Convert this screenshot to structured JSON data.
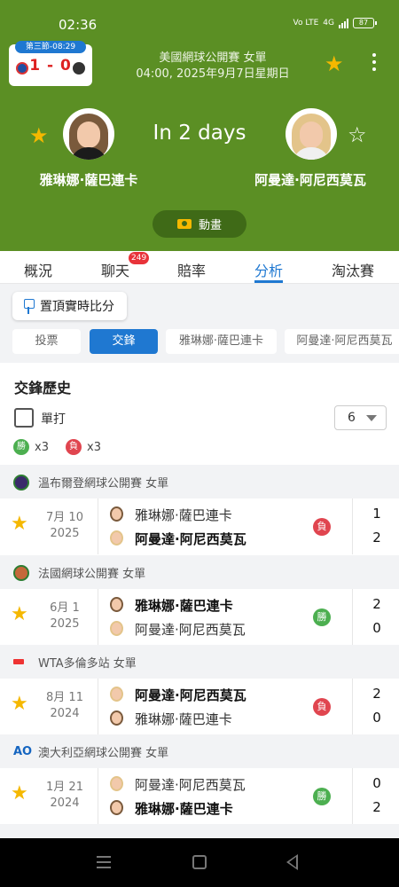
{
  "status_bar": {
    "time": "02:36",
    "net": "Vo LTE",
    "signal": "4G",
    "battery": "87"
  },
  "live_card": {
    "period": "第三節-08:29",
    "score": "1 - 0"
  },
  "event": {
    "title": "美國網球公開賽 女單",
    "datetime": "04:00, 2025年9月7日星期日"
  },
  "players": {
    "left": "雅琳娜·薩巴連卡",
    "right": "阿曼達·阿尼西莫瓦"
  },
  "countdown": "In 2 days",
  "animation_label": "動畫",
  "tabs": [
    "概況",
    "聊天",
    "賠率",
    "分析",
    "淘汰賽"
  ],
  "chat_badge": "249",
  "pin_label": "置頂實時比分",
  "chips": [
    "投票",
    "交鋒",
    "雅琳娜·薩巴連卡",
    "阿曼達·阿尼西莫瓦"
  ],
  "h2h": {
    "title": "交鋒歷史",
    "single_label": "單打",
    "count": "6",
    "win_badge": "勝",
    "loss_badge": "負",
    "wins": "x3",
    "losses": "x3"
  },
  "matches": [
    {
      "competition": "溫布爾登網球公開賽 女單",
      "date": "7月 10",
      "year": "2025",
      "p1": "雅琳娜·薩巴連卡",
      "p2": "阿曼達·阿尼西莫瓦",
      "result": "負",
      "s1": "1",
      "s2": "2"
    },
    {
      "competition": "法國網球公開賽 女單",
      "date": "6月 1",
      "year": "2025",
      "p1": "雅琳娜·薩巴連卡",
      "p2": "阿曼達·阿尼西莫瓦",
      "result": "勝",
      "s1": "2",
      "s2": "0"
    },
    {
      "competition": "WTA多倫多站 女單",
      "date": "8月 11",
      "year": "2024",
      "p1": "阿曼達·阿尼西莫瓦",
      "p2": "雅琳娜·薩巴連卡",
      "result": "負",
      "s1": "2",
      "s2": "0"
    },
    {
      "competition": "澳大利亞網球公開賽 女單",
      "date": "1月 21",
      "year": "2024",
      "p1": "阿曼達·阿尼西莫瓦",
      "p2": "雅琳娜·薩巴連卡",
      "result": "勝",
      "s1": "0",
      "s2": "2"
    }
  ],
  "colors": {
    "header": "#5b8f24",
    "accent": "#1f78d1",
    "star": "#f5b800",
    "win": "#4caf50",
    "loss": "#e0454f"
  }
}
